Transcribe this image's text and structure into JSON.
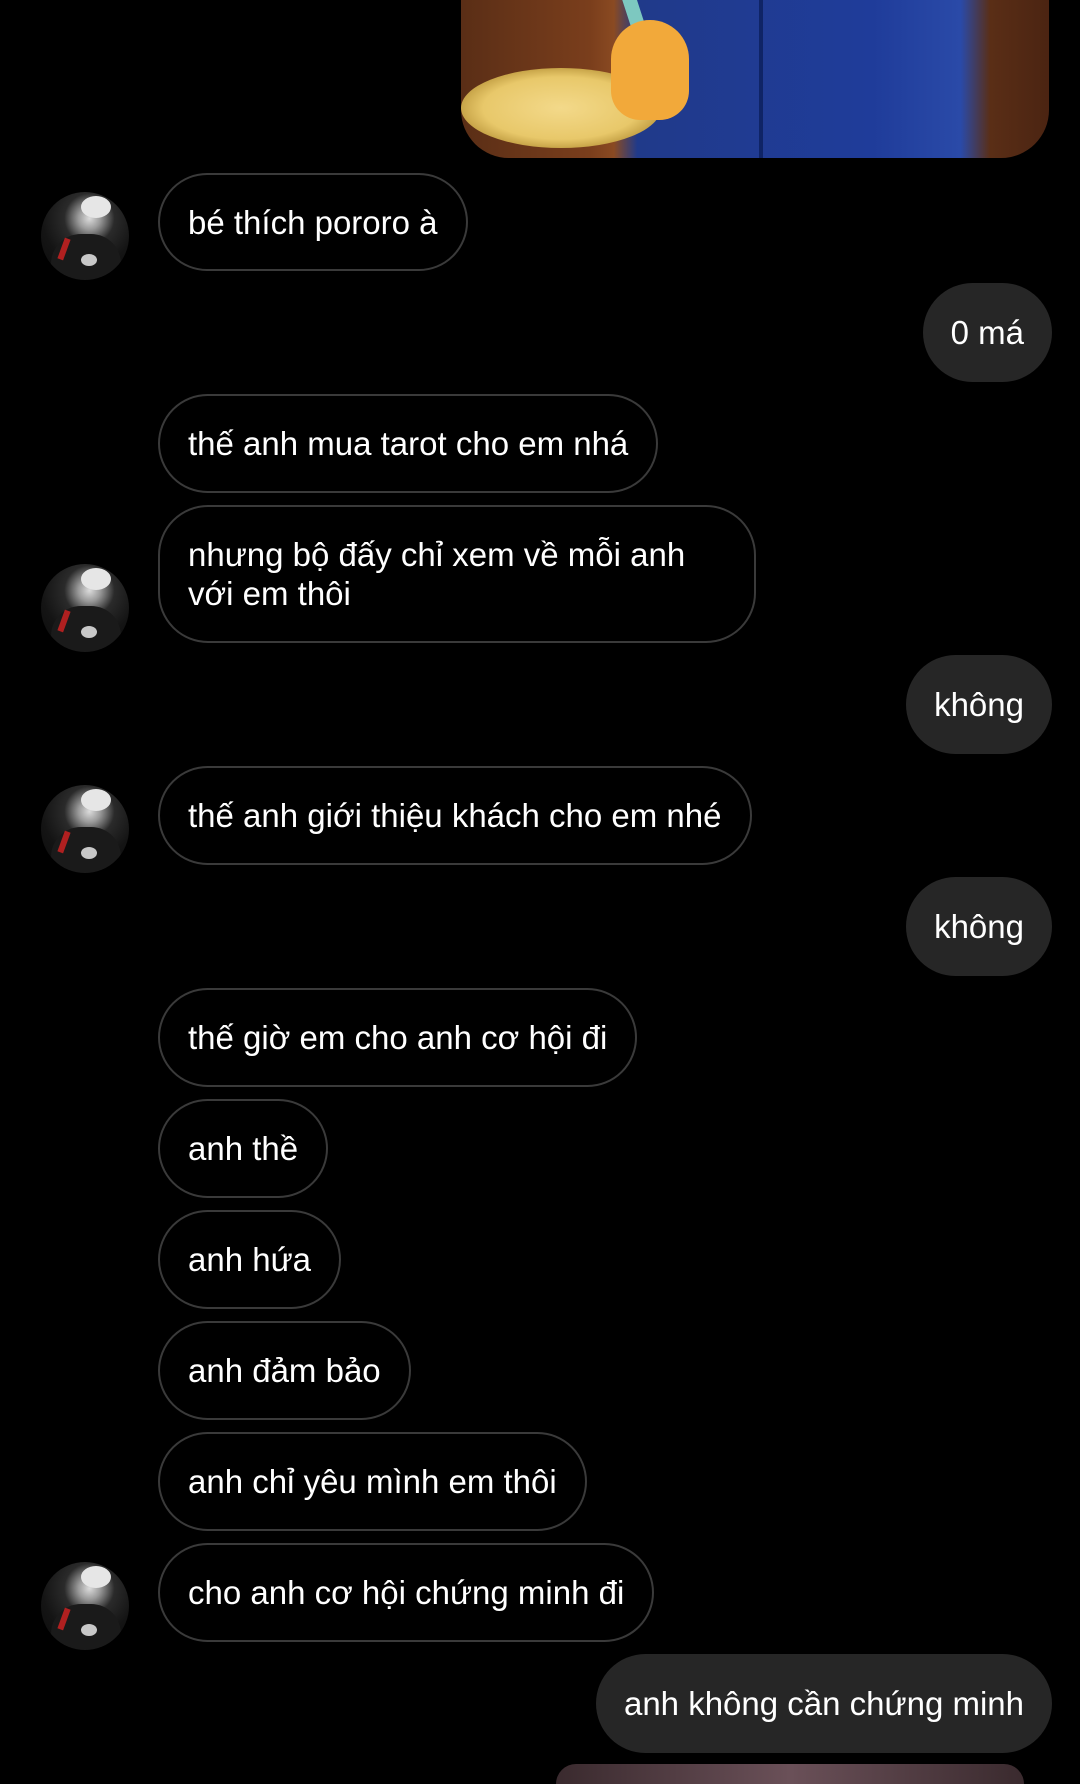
{
  "top_image": {
    "description_icon": "pororo-photo"
  },
  "messages": [
    {
      "side": "in",
      "text": "bé thích pororo à"
    },
    {
      "side": "out",
      "text": "0 má"
    },
    {
      "side": "in",
      "text": "thế anh mua tarot cho em nhá"
    },
    {
      "side": "in",
      "text": "nhưng bộ đấy chỉ xem về mỗi anh với em thôi"
    },
    {
      "side": "out",
      "text": "không"
    },
    {
      "side": "in",
      "text": "thế anh giới thiệu khách cho em nhé"
    },
    {
      "side": "out",
      "text": "không"
    },
    {
      "side": "in",
      "text": "thế giờ em cho anh cơ hội đi"
    },
    {
      "side": "in",
      "text": "anh thề"
    },
    {
      "side": "in",
      "text": "anh hứa"
    },
    {
      "side": "in",
      "text": "anh đảm bảo"
    },
    {
      "side": "in",
      "text": "anh chỉ yêu mình em thôi"
    },
    {
      "side": "in",
      "text": "cho anh cơ hội chứng minh đi"
    },
    {
      "side": "out",
      "text": "anh không cần chứng minh"
    }
  ],
  "colors": {
    "background": "#000000",
    "incoming_border": "#3a3a3a",
    "outgoing_fill": "#262626",
    "text": "#ffffff"
  }
}
